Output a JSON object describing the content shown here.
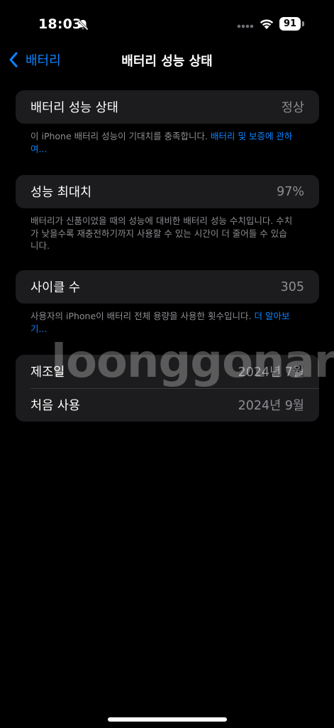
{
  "status_bar": {
    "time": "18:03",
    "battery_level": "91",
    "icons": [
      "bell-slash-icon",
      "cellular-signal-icon",
      "wifi-icon",
      "battery-icon"
    ]
  },
  "nav": {
    "back_label": "배터리",
    "title": "배터리 성능 상태"
  },
  "sections": {
    "health": {
      "label": "배터리 성능 상태",
      "value": "정상",
      "footnote_text": "이 iPhone 배터리 성능이 기대치를 충족합니다. ",
      "footnote_link": "배터리 및 보증에 관하여..."
    },
    "max_capacity": {
      "label": "성능 최대치",
      "value": "97%",
      "footnote_text": "배터리가 신품이었을 때의 성능에 대비한 배터리 성능 수치입니다. 수치가 낮을수록 재충전하기까지 사용할 수 있는 시간이 더 줄어들 수 있습니다."
    },
    "cycle_count": {
      "label": "사이클 수",
      "value": "305",
      "footnote_text": "사용자의 iPhone이 배터리 전체 용량을 사용한 횟수입니다. ",
      "footnote_link": "더 알아보기..."
    },
    "dates": {
      "manufacture_label": "제조일",
      "manufacture_value": "2024년 7월",
      "first_use_label": "처음 사용",
      "first_use_value": "2024년 9월"
    }
  },
  "watermark": "loonggonara",
  "colors": {
    "background": "#000000",
    "cell": "#1c1c1e",
    "accent": "#0a84ff",
    "secondary_text": "#8e8e93"
  }
}
